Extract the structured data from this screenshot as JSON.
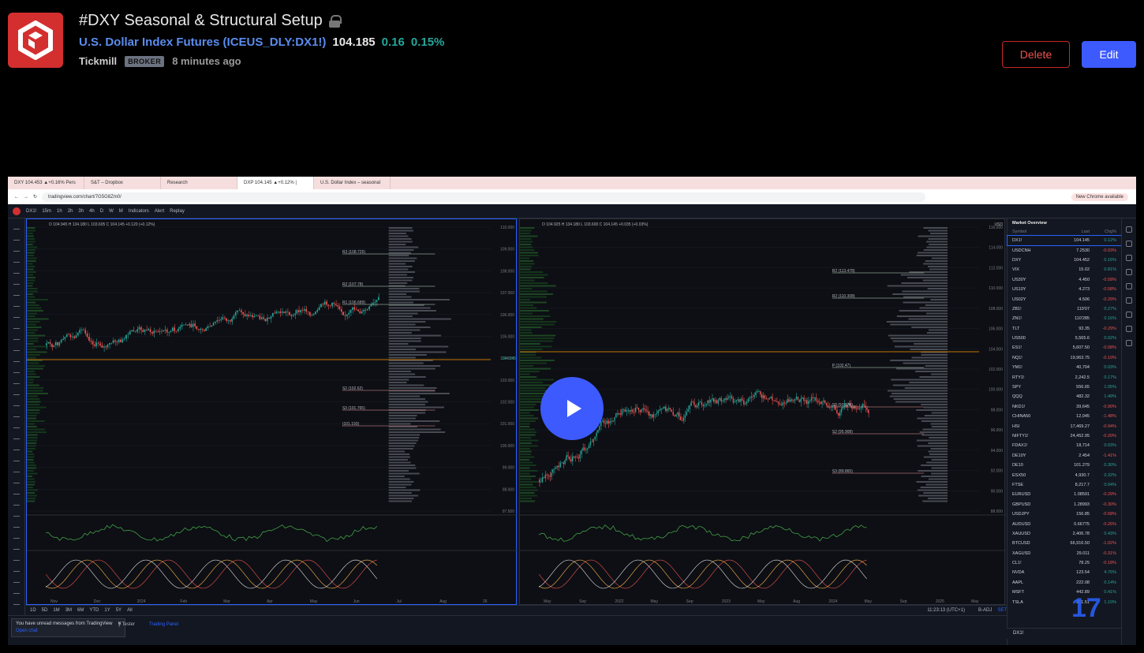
{
  "idea": {
    "title": "#DXY Seasonal & Structural Setup",
    "symbol_name": "U.S. Dollar Index Futures",
    "symbol_ticker": "ICEUS_DLY:DX1!",
    "open_paren": "(",
    "close_paren": ")",
    "price": "104.185",
    "change": "0.16",
    "change_pct": "0.15%",
    "author": "Tickmill",
    "author_badge": "BROKER",
    "time_ago": "8 minutes ago"
  },
  "actions": {
    "delete_label": "Delete",
    "edit_label": "Edit"
  },
  "browser": {
    "tabs": [
      "DXY 104.453 ▲+0.16% Pers",
      "S&T – Dropbox",
      "Research",
      "DXP 104.145 ▲+0.12% |",
      "U.S. Dollar Index – seasonal"
    ],
    "url": "tradingview.com/chart/7G5G8Zm0/",
    "chrome_banner": "New Chrome available"
  },
  "tv_toolbar": {
    "symbol": "DX1!",
    "intervals": [
      "15m",
      "1h",
      "2h",
      "3h",
      "4h",
      "D",
      "W",
      "M"
    ],
    "indicators": "Indicators",
    "alert": "Alert",
    "replay": "Replay"
  },
  "left_chart": {
    "ohlc": "O 104.945 H 134.180 L 103.605 C 104.145 +0.120 (+0.12%)",
    "price_axis": [
      "110.000",
      "109.000",
      "108.000",
      "107.000",
      "106.000",
      "105.000",
      "104.000",
      "103.000",
      "102.000",
      "101.000",
      "100.000",
      "99.000",
      "98.000",
      "97.500"
    ],
    "time_axis": [
      "Nov",
      "Dec",
      "2024",
      "Feb",
      "Mar",
      "Apr",
      "May",
      "Jun",
      "Jul",
      "Aug",
      "26"
    ],
    "levels": [
      "R3 (108.725)",
      "R2 (107.78)",
      "R1 (106.689)",
      "S2 (102.62)",
      "S3 (101.765)",
      "(101.193)"
    ],
    "osc_axis": [
      "20.000",
      "0.000",
      "-20.000"
    ],
    "stoch_axis": [
      "80.00",
      "50.00",
      "20.00",
      "0.00"
    ],
    "last_price": "104.145"
  },
  "right_chart": {
    "ohlc": "O 104.925 H 134.180 L 103.600 C 104.145 +0.035 (+0.03%)",
    "price_axis": [
      "116.000",
      "114.000",
      "112.000",
      "110.000",
      "108.000",
      "106.000",
      "104.000",
      "102.000",
      "100.000",
      "98.000",
      "96.000",
      "94.000",
      "92.000",
      "90.000",
      "88.000"
    ],
    "time_axis": [
      "May",
      "Sep",
      "2022",
      "May",
      "Sep",
      "2023",
      "May",
      "Aug",
      "2024",
      "May",
      "Sep",
      "2025",
      "May"
    ],
    "levels": [
      "R2 (113.478)",
      "R2 (110.308)",
      "P (102.47)",
      "S2 (97.176)",
      "S2 (95.908)",
      "S3 (89.865)"
    ],
    "currency": "USD"
  },
  "watchlist": {
    "title": "Market Overview",
    "columns": [
      "Symbol",
      "Last",
      "Chg%"
    ],
    "rows": [
      {
        "s": "DX1!",
        "l": "104.145",
        "c": "0.12%",
        "d": "pos"
      },
      {
        "s": "USDCNH",
        "l": "7.2530",
        "c": "-0.03%",
        "d": "neg"
      },
      {
        "s": "DXY",
        "l": "104.452",
        "c": "0.16%",
        "d": "pos"
      },
      {
        "s": "VIX",
        "l": "15.02",
        "c": "0.81%",
        "d": "pos"
      },
      {
        "s": "US30Y",
        "l": "4.450",
        "c": "-0.58%",
        "d": "neg"
      },
      {
        "s": "US10Y",
        "l": "4.273",
        "c": "-0.58%",
        "d": "neg"
      },
      {
        "s": "US02Y",
        "l": "4.506",
        "c": "-0.29%",
        "d": "neg"
      },
      {
        "s": "ZB1!",
        "l": "119'07",
        "c": "0.27%",
        "d": "pos"
      },
      {
        "s": "ZN1!",
        "l": "110'285",
        "c": "0.16%",
        "d": "pos"
      },
      {
        "s": "TLT",
        "l": "93.35",
        "c": "-0.29%",
        "d": "neg"
      },
      {
        "s": "US500",
        "l": "5,565.6",
        "c": "0.02%",
        "d": "pos"
      },
      {
        "s": "ES1!",
        "l": "5,607.50",
        "c": "-0.08%",
        "d": "neg"
      },
      {
        "s": "NQ1!",
        "l": "19,963.75",
        "c": "-0.10%",
        "d": "neg"
      },
      {
        "s": "YM1!",
        "l": "40,704",
        "c": "0.03%",
        "d": "pos"
      },
      {
        "s": "RTY1!",
        "l": "2,242.5",
        "c": "0.17%",
        "d": "pos"
      },
      {
        "s": "SPY",
        "l": "556.65",
        "c": "1.05%",
        "d": "pos"
      },
      {
        "s": "QQQ",
        "l": "482.32",
        "c": "1.49%",
        "d": "pos"
      },
      {
        "s": "NKD1!",
        "l": "39,645",
        "c": "-0.90%",
        "d": "neg"
      },
      {
        "s": "CHINA50",
        "l": "12,045",
        "c": "-1.48%",
        "d": "neg"
      },
      {
        "s": "HSI",
        "l": "17,469.27",
        "c": "-0.94%",
        "d": "neg"
      },
      {
        "s": "NIFTY1!",
        "l": "24,452.95",
        "c": "-0.20%",
        "d": "neg"
      },
      {
        "s": "FDAX1!",
        "l": "18,714",
        "c": "0.03%",
        "d": "pos"
      },
      {
        "s": "DE10Y",
        "l": "2.454",
        "c": "-1.41%",
        "d": "neg"
      },
      {
        "s": "DE10",
        "l": "101.279",
        "c": "0.30%",
        "d": "pos"
      },
      {
        "s": "ESX50",
        "l": "4,930.7",
        "c": "0.32%",
        "d": "pos"
      },
      {
        "s": "FTSE",
        "l": "8,217.7",
        "c": "0.04%",
        "d": "pos"
      },
      {
        "s": "EURUSD",
        "l": "1.08591",
        "c": "-0.29%",
        "d": "neg"
      },
      {
        "s": "GBPUSD",
        "l": "1.28993",
        "c": "-0.30%",
        "d": "neg"
      },
      {
        "s": "USDJPY",
        "l": "156.85",
        "c": "-0.58%",
        "d": "neg"
      },
      {
        "s": "AUDUSD",
        "l": "0.66775",
        "c": "-0.26%",
        "d": "neg"
      },
      {
        "s": "XAUUSD",
        "l": "2,406.78",
        "c": "0.43%",
        "d": "pos"
      },
      {
        "s": "BTCUSD",
        "l": "66,916.50",
        "c": "-1.02%",
        "d": "neg"
      },
      {
        "s": "XAGUSD",
        "l": "29.011",
        "c": "-0.31%",
        "d": "neg"
      },
      {
        "s": "CL1!",
        "l": "78.25",
        "c": "-0.18%",
        "d": "neg"
      },
      {
        "s": "NVDA",
        "l": "123.54",
        "c": "4.76%",
        "d": "pos"
      },
      {
        "s": "AAPL",
        "l": "222.08",
        "c": "0.14%",
        "d": "pos"
      },
      {
        "s": "MSFT",
        "l": "442.89",
        "c": "0.41%",
        "d": "pos"
      },
      {
        "s": "TSLA",
        "l": "251.51",
        "c": "1.10%",
        "d": "pos"
      }
    ],
    "footer_symbol": "DX1!"
  },
  "bottom_bar": {
    "ranges": [
      "1D",
      "5D",
      "1M",
      "3M",
      "6M",
      "YTD",
      "1Y",
      "5Y",
      "All"
    ],
    "time": "11:23:13 (UTC+1)",
    "adj": "B-ADJ",
    "set": "SET"
  },
  "panel": {
    "strategy_tester": "y Tester",
    "trading_panel": "Trading Panel",
    "notif_text": "You have unread messages from TradingView",
    "notif_open": "Open chat"
  },
  "colors": {
    "accent": "#3d5afe",
    "delete": "#ef5350",
    "up": "#26a69a",
    "down": "#ef5350",
    "logo": "#d32f2f"
  }
}
